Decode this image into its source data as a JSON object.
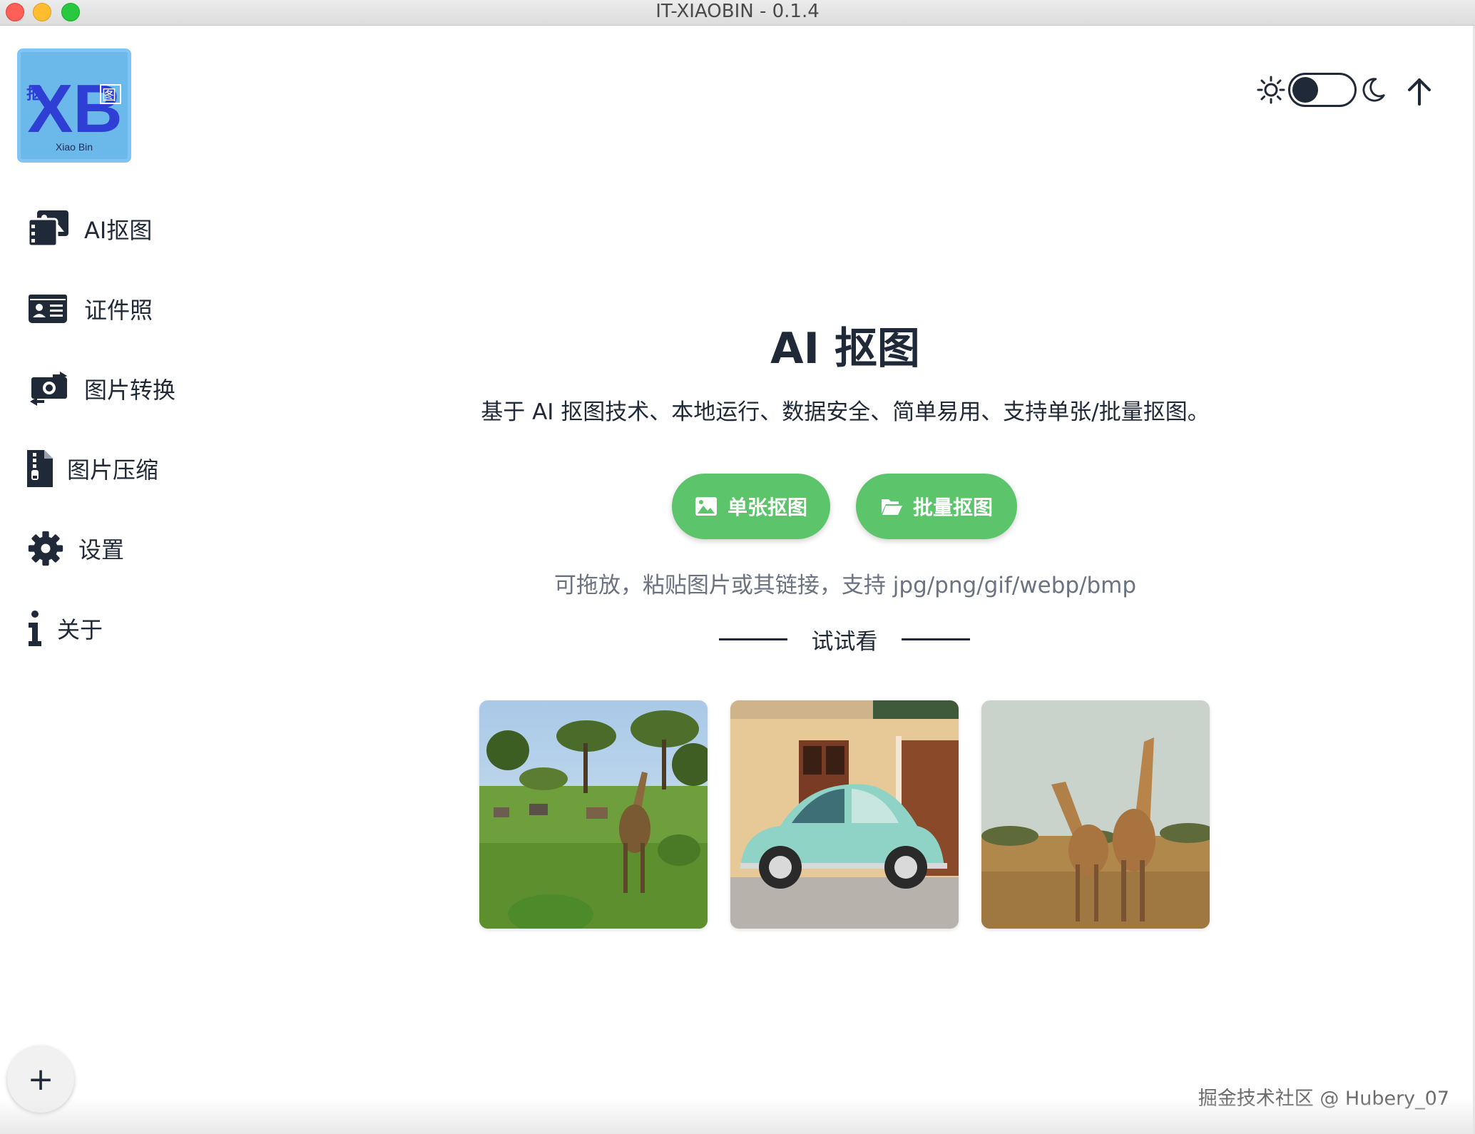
{
  "window": {
    "title": "IT-XIAOBIN - 0.1.4"
  },
  "logo": {
    "main": "XB",
    "left_char": "抠",
    "right_char": "图",
    "caption": "Xiao Bin"
  },
  "sidebar": {
    "items": [
      {
        "label": "AI抠图",
        "icon": "images-icon"
      },
      {
        "label": "证件照",
        "icon": "id-card-icon"
      },
      {
        "label": "图片转换",
        "icon": "money-bill-transfer-icon"
      },
      {
        "label": "图片压缩",
        "icon": "file-zipper-icon"
      },
      {
        "label": "设置",
        "icon": "gear-icon"
      },
      {
        "label": "关于",
        "icon": "info-icon"
      }
    ]
  },
  "header": {
    "theme": "light",
    "icons": [
      "sun-icon",
      "moon-icon",
      "arrow-up-icon"
    ]
  },
  "main": {
    "title": "AI 抠图",
    "subtitle": "基于 AI 抠图技术、本地运行、数据安全、简单易用、支持单张/批量抠图。",
    "buttons": {
      "single": "单张抠图",
      "batch": "批量抠图"
    },
    "hint": "可拖放，粘贴图片或其链接，支持 jpg/png/gif/webp/bmp",
    "try_label": "试试看"
  },
  "footer": {
    "fab": "+",
    "watermark": "掘金技术社区 @ Hubery_07"
  },
  "colors": {
    "primary_button": "#5cc46a",
    "logo_bg": "#6bb8ea",
    "text": "#1f2937"
  }
}
